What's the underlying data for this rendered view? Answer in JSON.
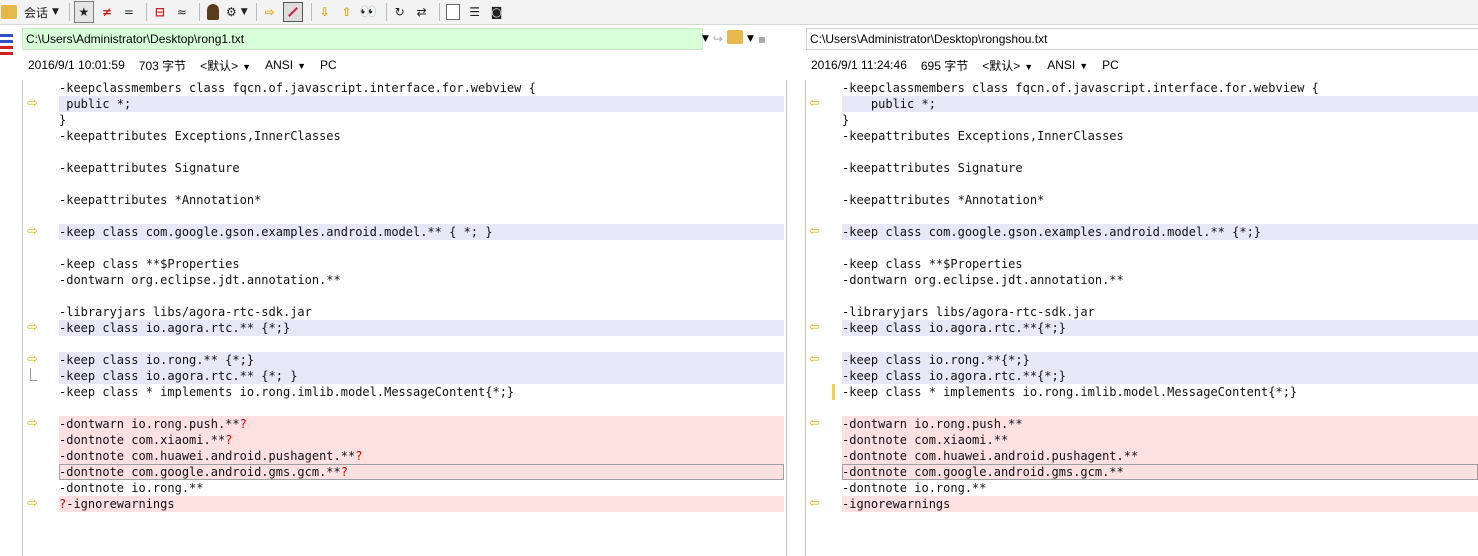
{
  "toolbar": {
    "session_label": "会话",
    "equal_symbol": "=",
    "not_equal_symbol": "≠",
    "approx_symbol": "≈"
  },
  "left": {
    "path": "C:\\Users\\Administrator\\Desktop\\rong1.txt",
    "date": "2016/9/1 10:01:59",
    "size": "703 字节",
    "encoding_profile": "<默认>",
    "charset": "ANSI",
    "line_ending": "PC"
  },
  "right": {
    "path": "C:\\Users\\Administrator\\Desktop\\rongshou.txt",
    "date": "2016/9/1 11:24:46",
    "size": "695 字节",
    "encoding_profile": "<默认>",
    "charset": "ANSI",
    "line_ending": "PC"
  },
  "lines": [
    {
      "left": "-keepclassmembers class fqcn.of.javascript.interface.for.webview {",
      "right": "-keepclassmembers class fqcn.of.javascript.interface.for.webview {",
      "style": "plain"
    },
    {
      "left": " public *;",
      "right": "    public *;",
      "style": "diff"
    },
    {
      "left": "}",
      "right": "}",
      "style": "plain"
    },
    {
      "left": "-keepattributes Exceptions,InnerClasses",
      "right": "-keepattributes Exceptions,InnerClasses",
      "style": "plain"
    },
    {
      "left": "",
      "right": "",
      "style": "plain"
    },
    {
      "left": "-keepattributes Signature",
      "right": "-keepattributes Signature",
      "style": "plain"
    },
    {
      "left": "",
      "right": "",
      "style": "plain"
    },
    {
      "left": "-keepattributes *Annotation*",
      "right": "-keepattributes *Annotation*",
      "style": "plain"
    },
    {
      "left": "",
      "right": "",
      "style": "plain"
    },
    {
      "left": "-keep class com.google.gson.examples.android.model.** { *; }",
      "right": "-keep class com.google.gson.examples.android.model.** {*;}",
      "style": "diff"
    },
    {
      "left": "",
      "right": "",
      "style": "plain"
    },
    {
      "left": "-keep class **$Properties",
      "right": "-keep class **$Properties",
      "style": "plain"
    },
    {
      "left": "-dontwarn org.eclipse.jdt.annotation.**",
      "right": "-dontwarn org.eclipse.jdt.annotation.**",
      "style": "plain"
    },
    {
      "left": "",
      "right": "",
      "style": "plain"
    },
    {
      "left": "-libraryjars libs/agora-rtc-sdk.jar",
      "right": "-libraryjars libs/agora-rtc-sdk.jar",
      "style": "plain"
    },
    {
      "left": "-keep class io.agora.rtc.** {*;}",
      "right": "-keep class io.agora.rtc.**{*;}",
      "style": "diff"
    },
    {
      "left": "",
      "right": "",
      "style": "plain"
    },
    {
      "left": "-keep class io.rong.** {*;}",
      "right": "-keep class io.rong.**{*;}",
      "style": "diff"
    },
    {
      "left": "-keep class io.agora.rtc.** {*; }",
      "right": "-keep class io.agora.rtc.**{*;}",
      "style": "diff"
    },
    {
      "left": "-keep class * implements io.rong.imlib.model.MessageContent{*;}",
      "right": "-keep class * implements io.rong.imlib.model.MessageContent{*;}",
      "style": "plain"
    },
    {
      "left": "",
      "right": "",
      "style": "plain"
    },
    {
      "left": "-dontwarn io.rong.push.**",
      "left_suffix": "?",
      "right": "-dontwarn io.rong.push.**",
      "style": "pink"
    },
    {
      "left": "-dontnote com.xiaomi.**",
      "left_suffix": "?",
      "right": "-dontnote com.xiaomi.**",
      "style": "pink"
    },
    {
      "left": "-dontnote com.huawei.android.pushagent.**",
      "left_suffix": "?",
      "right": "-dontnote com.huawei.android.pushagent.**",
      "style": "pink"
    },
    {
      "left": "-dontnote com.google.android.gms.gcm.**",
      "left_suffix": "?",
      "right": "-dontnote com.google.android.gms.gcm.**",
      "style": "pink-focus"
    },
    {
      "left": "-dontnote io.rong.**",
      "right": "-dontnote io.rong.**",
      "style": "plain"
    },
    {
      "left": "-ignorewarnings",
      "left_prefix": "?",
      "right": "-ignorewarnings",
      "style": "pink"
    }
  ]
}
